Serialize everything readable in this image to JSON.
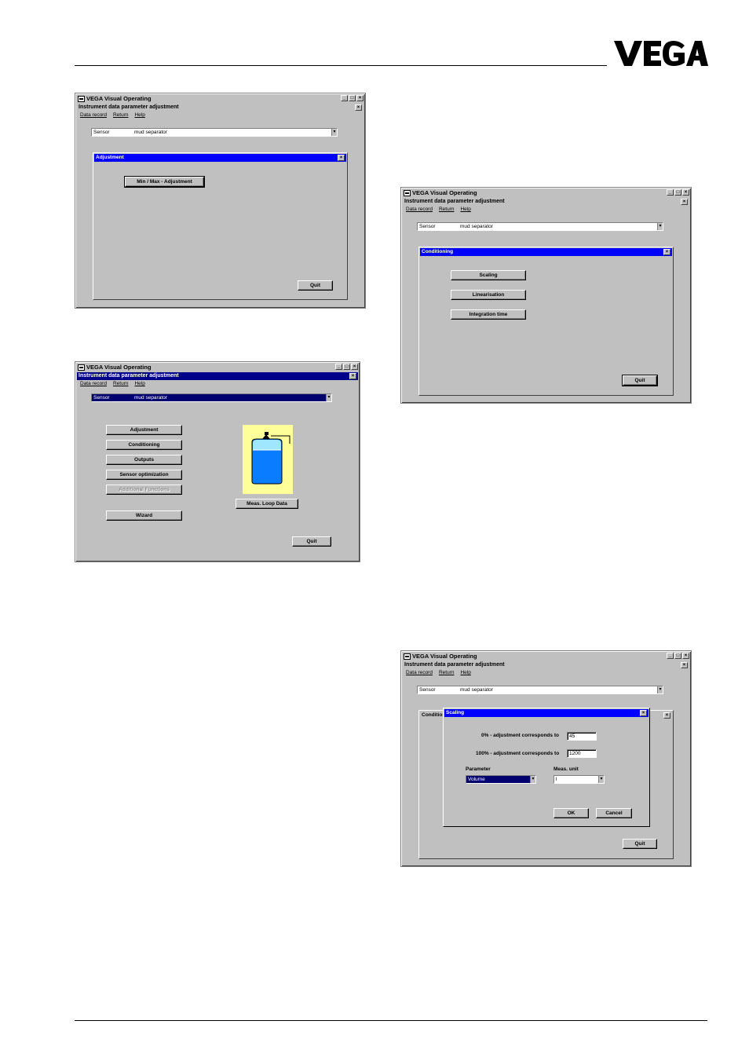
{
  "brand": "VEGA",
  "app_title": "VEGA Visual Operating",
  "sub_title": "Instrument data parameter adjustment",
  "menu": [
    "Data record",
    "Return",
    "Help"
  ],
  "sensor_label": "Sensor",
  "sensor_value": "mud separator",
  "quit_label": "Quit",
  "win1": {
    "dialog_title": "Adjustment",
    "minmax_button": "Min / Max - Adjustment"
  },
  "win2": {
    "buttons": [
      "Adjustment",
      "Conditioning",
      "Outputs",
      "Sensor optimization",
      "Additional Functions",
      "Wizard"
    ],
    "meas_loop_button": "Meas. Loop Data"
  },
  "win3": {
    "dialog_title": "Conditioning",
    "buttons": [
      "Scaling",
      "Linearisation",
      "Integration time"
    ]
  },
  "win4": {
    "behind_dialog_title": "Condition",
    "dialog_title": "Scaling",
    "zero_label": "0% - adjustment corresponds to",
    "zero_value": "45",
    "hundred_label": "100% - adjustment corresponds to",
    "hundred_value": "1200",
    "parameter_label": "Parameter",
    "parameter_value": "Volume",
    "unit_label": "Meas. unit",
    "unit_value": "l",
    "ok_label": "OK",
    "cancel_label": "Cancel"
  },
  "colors": {
    "title_blue": "#0000ff",
    "dark_blue": "#00008b",
    "tank_bg": "#ffff99",
    "water": "#0a7cff",
    "gray": "#c0c0c0"
  }
}
